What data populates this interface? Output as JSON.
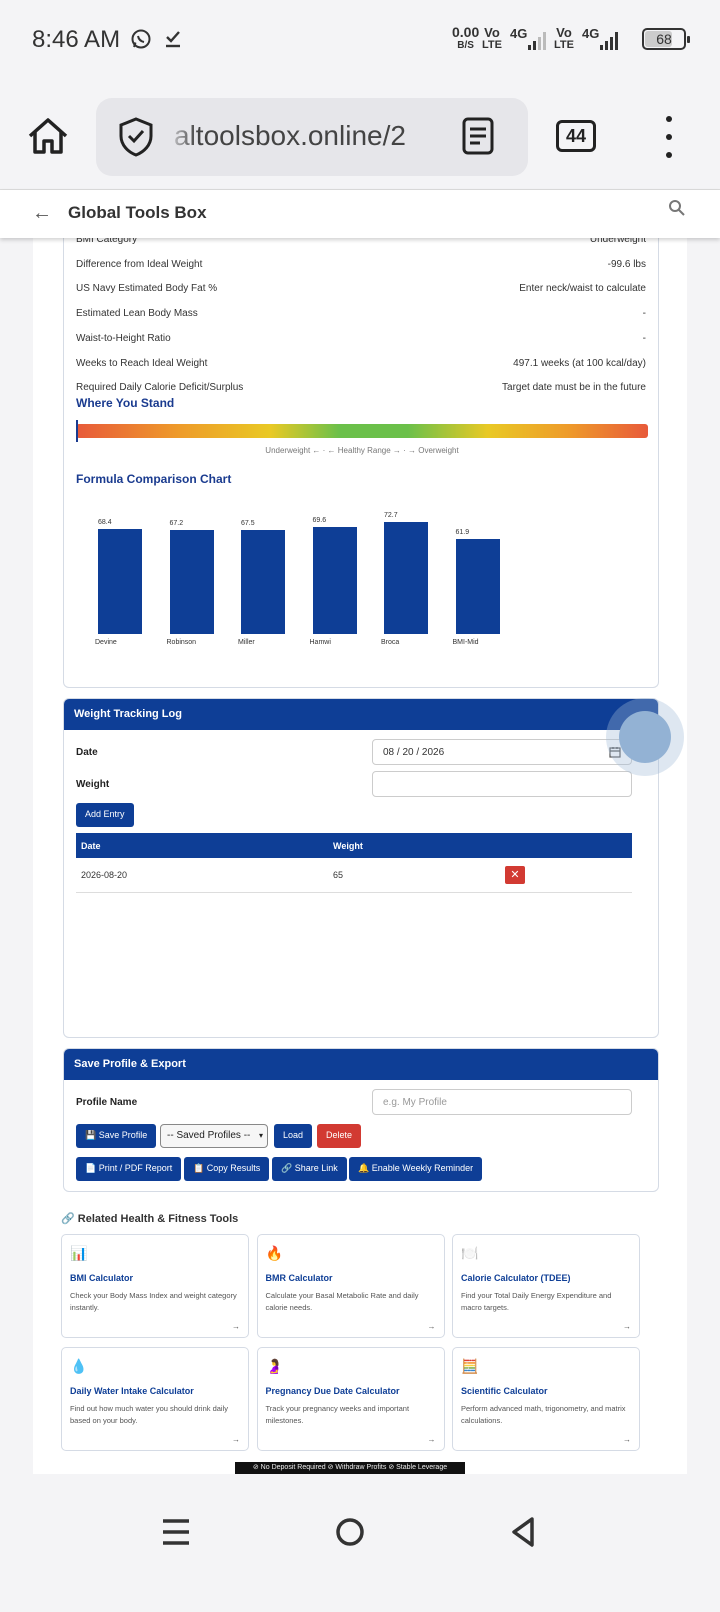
{
  "status_bar": {
    "time": "8:46 AM",
    "net_speed": "0.00",
    "net_unit": "B/S",
    "volte1": "Vo\nLTE",
    "sig1": "4G",
    "volte2": "Vo\nLTE",
    "sig2": "4G",
    "battery": "68",
    "icons": [
      "whatsapp-icon",
      "checkmark-icon"
    ]
  },
  "browser": {
    "url": "altoolsbox.online/2",
    "tab_count": "44"
  },
  "app_header": {
    "back_label": "←",
    "title": "Global Tools Box"
  },
  "results": {
    "rows": [
      {
        "label": "BMI Category",
        "value": "Underweight"
      },
      {
        "label": "Difference from Ideal Weight",
        "value": "-99.6 lbs"
      },
      {
        "label": "US Navy Estimated Body Fat %",
        "value": "Enter neck/waist to calculate"
      },
      {
        "label": "Estimated Lean Body Mass",
        "value": "-"
      },
      {
        "label": "Waist-to-Height Ratio",
        "value": "-"
      },
      {
        "label": "Weeks to Reach Ideal Weight",
        "value": "497.1 weeks (at 100 kcal/day)"
      },
      {
        "label": "Required Daily Calorie Deficit/Surplus",
        "value": "Target date must be in the future"
      }
    ],
    "where_title": "Where You Stand",
    "where_position": 0.0,
    "where_caption": "Underweight ← · ← Healthy Range → · → Overweight",
    "chart_title": "Formula Comparison Chart"
  },
  "chart_data": {
    "type": "bar",
    "title": "Formula Comparison Chart",
    "categories": [
      "Devine",
      "Robinson",
      "Miller",
      "Hamwi",
      "Broca",
      "BMI-Mid"
    ],
    "values": [
      68.4,
      67.2,
      67.5,
      69.6,
      72.7,
      61.9
    ],
    "data_labels": [
      "68.4",
      "67.2",
      "67.5",
      "69.6",
      "72.7",
      "61.9"
    ],
    "ylim": [
      0,
      80
    ],
    "color": "#0e3e96"
  },
  "tracking": {
    "title": "Weight Tracking Log",
    "date_label": "Date",
    "date_value": "08 / 20 / 2026",
    "weight_label": "Weight",
    "weight_value": "",
    "add_button": "Add Entry",
    "columns": [
      "Date",
      "Weight",
      ""
    ],
    "entries": [
      {
        "date": "2026-08-20",
        "weight": "65",
        "delete": "✕"
      }
    ]
  },
  "profile": {
    "title": "Save Profile & Export",
    "name_label": "Profile Name",
    "name_placeholder": "e.g. My Profile",
    "save_button": "💾 Save Profile",
    "select_value": "-- Saved Profiles --",
    "load_button": "Load",
    "delete_button": "Delete",
    "print_button": "📄 Print / PDF Report",
    "copy_button": "📋 Copy Results",
    "share_button": "🔗 Share Link",
    "reminder_button": "🔔 Enable Weekly Reminder"
  },
  "related": {
    "title": "🔗 Related Health & Fitness Tools",
    "tools": [
      {
        "icon": "📊",
        "title": "BMI Calculator",
        "desc": "Check your Body Mass Index and weight category instantly.",
        "arrow": "→"
      },
      {
        "icon": "🔥",
        "title": "BMR Calculator",
        "desc": "Calculate your Basal Metabolic Rate and daily calorie needs.",
        "arrow": "→"
      },
      {
        "icon": "🍽️",
        "title": "Calorie Calculator (TDEE)",
        "desc": "Find your Total Daily Energy Expenditure and macro targets.",
        "arrow": "→"
      },
      {
        "icon": "💧",
        "title": "Daily Water Intake Calculator",
        "desc": "Find out how much water you should drink daily based on your body.",
        "arrow": "→"
      },
      {
        "icon": "🤰",
        "title": "Pregnancy Due Date Calculator",
        "desc": "Track your pregnancy weeks and important milestones.",
        "arrow": "→"
      },
      {
        "icon": "🧮",
        "title": "Scientific Calculator",
        "desc": "Perform advanced math, trigonometry, and matrix calculations.",
        "arrow": "→"
      }
    ]
  },
  "banner": "⊘ No Deposit Required   ⊘ Withdraw Profits   ⊘ Stable Leverage"
}
